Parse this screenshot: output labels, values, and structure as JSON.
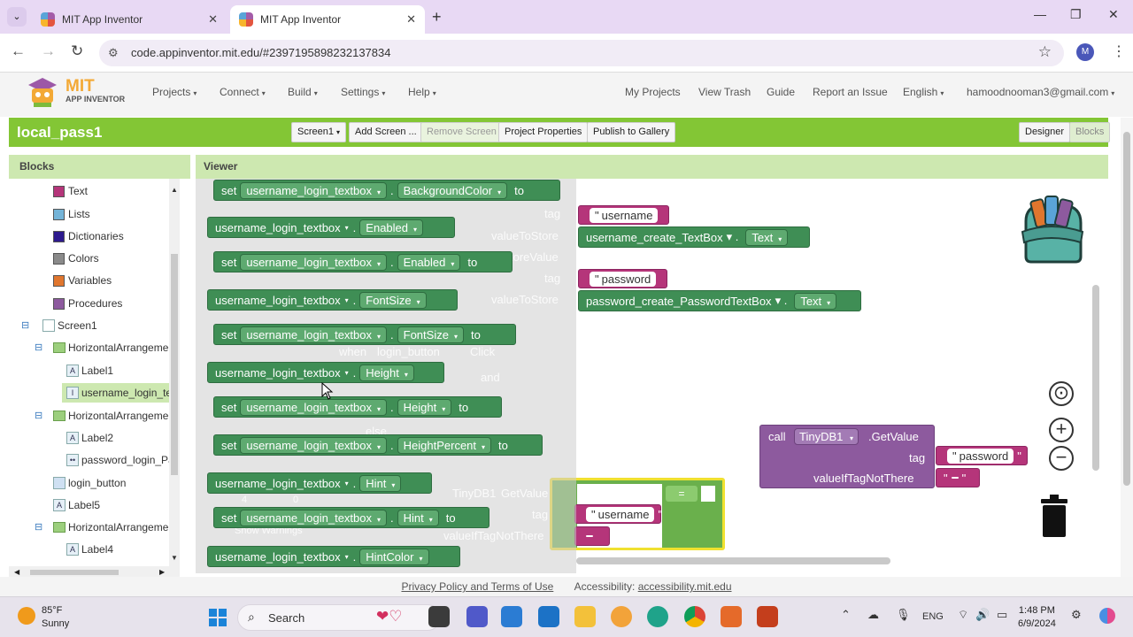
{
  "browser": {
    "tabs": [
      {
        "title": "MIT App Inventor",
        "close": "✕"
      },
      {
        "title": "MIT App Inventor",
        "close": "✕"
      }
    ],
    "new_tab": "+",
    "window": {
      "minimize": "—",
      "maximize": "❐",
      "close": "✕"
    },
    "url": "code.appinventor.mit.edu/#2397195898232137834",
    "profile_initial": "M"
  },
  "app": {
    "logo_line1": "MIT",
    "logo_line2": "APP INVENTOR",
    "menus": [
      "Projects",
      "Connect",
      "Build",
      "Settings",
      "Help"
    ],
    "links": [
      "My Projects",
      "View Trash",
      "Guide",
      "Report an Issue"
    ],
    "language": "English",
    "account": "hamoodnooman3@gmail.com"
  },
  "project": {
    "name": "local_pass1",
    "screen_select": "Screen1",
    "buttons": {
      "add_screen": "Add Screen ...",
      "remove_screen": "Remove Screen",
      "properties": "Project Properties",
      "publish": "Publish to Gallery",
      "designer": "Designer",
      "blocks": "Blocks"
    }
  },
  "blocks_panel": {
    "title": "Blocks",
    "builtins": [
      {
        "label": "Text",
        "color": "#b5357a"
      },
      {
        "label": "Lists",
        "color": "#74b4d8"
      },
      {
        "label": "Dictionaries",
        "color": "#2d1a8e"
      },
      {
        "label": "Colors",
        "color": "#8a8a8a"
      },
      {
        "label": "Variables",
        "color": "#e0762e"
      },
      {
        "label": "Procedures",
        "color": "#8d5a9e"
      }
    ],
    "components": {
      "screen": "Screen1",
      "harr1": "HorizontalArrangemen",
      "label1": "Label1",
      "username_box": "username_login_tex",
      "harr2": "HorizontalArrangemen",
      "label2": "Label2",
      "password_box": "password_login_Pa",
      "login_button": "login_button",
      "label5": "Label5",
      "harr3": "HorizontalArrangemen",
      "label4": "Label4"
    }
  },
  "viewer": {
    "title": "Viewer",
    "flyout_blocks": {
      "set": "set",
      "to": "to",
      "component": "username_login_textbox",
      "props": {
        "bg": "BackgroundColor",
        "enabled": "Enabled",
        "fontsize": "FontSize",
        "height": "Height",
        "heightpct": "HeightPercent",
        "hint": "Hint",
        "hintcolor": "HintColor"
      }
    },
    "ghost": {
      "tag": "tag",
      "value_to_store": "valueToStore",
      "store_value_partial": "toreValue",
      "login_button": "login_button",
      "click": "Click",
      "and": "and",
      "tinydb": "TinyDB1",
      "getvalue": "GetValue",
      "value_if_tag": "valueIfTagNotThere",
      "show_warnings": "Show Warnings",
      "warn_count": "4",
      "err_count": "0",
      "when": "when",
      "else": "else"
    },
    "workspace_blocks": {
      "str_username": "username",
      "username_create": "username_create_TextBox",
      "text_prop": "Text",
      "str_password": "password",
      "password_create": "password_create_PasswordTextBox",
      "call": "call",
      "tinydb": "TinyDB1",
      "getvalue": ".GetValue",
      "tag": "tag",
      "value_if_tag": "valueIfTagNotThere",
      "str_password2": "password",
      "compare_op": "=",
      "str_username2": "username"
    },
    "controls": {
      "center": "⊙",
      "zoom_in": "+",
      "zoom_out": "−"
    }
  },
  "footer": {
    "privacy": "Privacy Policy and Terms of Use",
    "accessibility_label": "Accessibility:",
    "accessibility_link": "accessibility.mit.edu"
  },
  "taskbar": {
    "temp": "85°F",
    "condition": "Sunny",
    "search": "Search",
    "lang": "ENG",
    "time": "1:48 PM",
    "date": "6/9/2024"
  }
}
